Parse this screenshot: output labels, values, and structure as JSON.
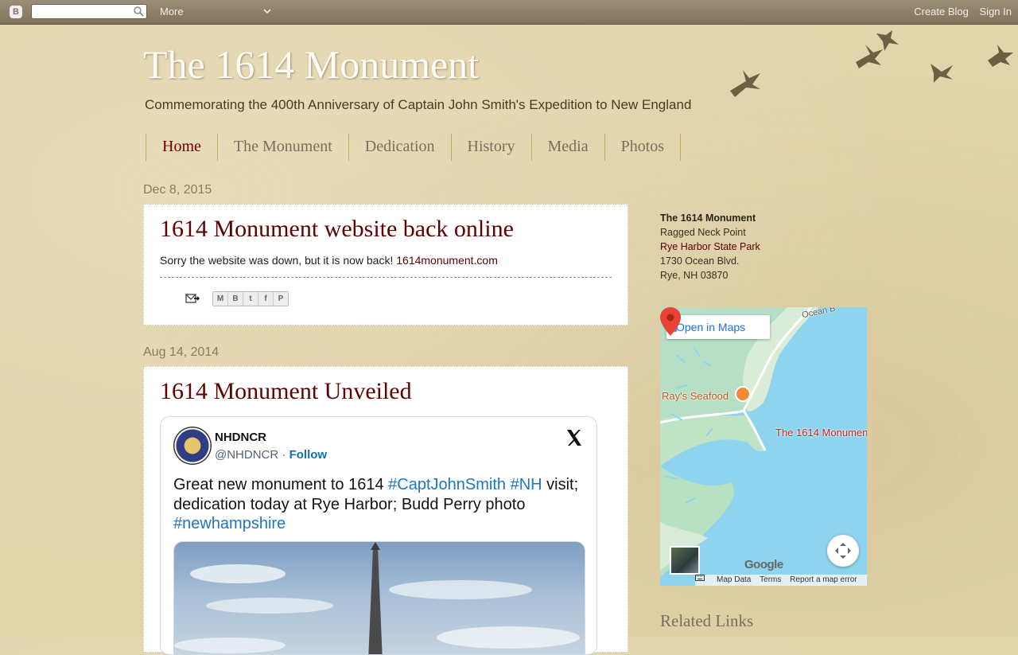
{
  "navbar": {
    "search_placeholder": "",
    "more_label": "More",
    "create_blog": "Create Blog",
    "sign_in": "Sign In"
  },
  "header": {
    "title": "The 1614 Monument",
    "description": "Commemorating the 400th Anniversary of Captain John Smith's Expedition to New England"
  },
  "tabs": [
    {
      "label": "Home",
      "active": true
    },
    {
      "label": "The Monument"
    },
    {
      "label": "Dedication"
    },
    {
      "label": "History"
    },
    {
      "label": "Media"
    },
    {
      "label": "Photos"
    }
  ],
  "posts": [
    {
      "date": "Dec 8, 2015",
      "title": "1614 Monument website back online",
      "body": "Sorry the website was down, but it is now back!",
      "link": "1614monument.com",
      "share": [
        "M",
        "B",
        "t",
        "f",
        "P"
      ]
    },
    {
      "date": "Aug 14, 2014",
      "title": "1614 Monument Unveiled",
      "tweet": {
        "name": "NHDNCR",
        "handle": "@NHDNCR",
        "separator": "·",
        "follow": "Follow",
        "text_1": "Great new monument to 1614 ",
        "tag_1": "#CaptJohnSmith",
        "text_2": " ",
        "tag_2": "#NH",
        "text_3": " visit; dedication today at Rye Harbor; Budd Perry photo ",
        "tag_3": "#newhampshire"
      }
    }
  ],
  "sidebar": {
    "address": {
      "name": "The 1614 Monument",
      "line1": "Ragged Neck Point",
      "park": "Rye Harbor State Park",
      "line2": "1730 Ocean Blvd.",
      "line3": "Rye, NH 03870"
    },
    "map": {
      "open_in_maps": "Open in Maps",
      "ocean_label": "Ocean B",
      "rays": "Ray's Seafood",
      "monument": "The 1614 Monument",
      "google": "Google",
      "map_data": "Map Data",
      "terms": "Terms",
      "report": "Report a map error"
    },
    "related_links": "Related Links"
  },
  "colors": {
    "title_red": "#600000",
    "tab_border": "#c6a959",
    "link_blue": "#1d76c4"
  }
}
